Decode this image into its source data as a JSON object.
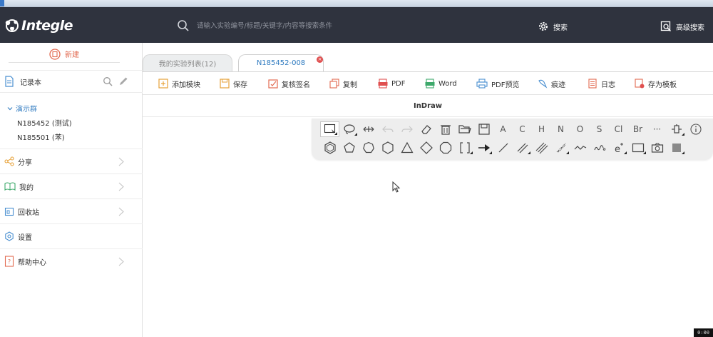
{
  "app": {
    "logo_text": "Integle",
    "search_placeholder": "请输入实验编号/标题/关键字/内容等搜索条件",
    "search_label": "搜索",
    "advanced_search_label": "高级搜索"
  },
  "sidebar": {
    "new_label": "新建",
    "notebook_label": "记录本",
    "group_label": "演示群",
    "tree_items": [
      {
        "label": "N185452 (测试)"
      },
      {
        "label": "N185501 (苯)"
      }
    ],
    "nav": [
      {
        "label": "分享",
        "icon": "share-icon"
      },
      {
        "label": "我的",
        "icon": "book-open-icon"
      },
      {
        "label": "回收站",
        "icon": "recycle-bin-icon"
      },
      {
        "label": "设置",
        "icon": "gear-icon"
      },
      {
        "label": "帮助中心",
        "icon": "help-icon"
      }
    ]
  },
  "tabs": [
    {
      "label": "我的实验列表(12)",
      "active": false
    },
    {
      "label": "N185452-008",
      "active": true
    }
  ],
  "toolbar": [
    {
      "label": "添加模块",
      "icon": "add-module-icon"
    },
    {
      "label": "保存",
      "icon": "save-icon"
    },
    {
      "label": "复核签名",
      "icon": "sign-icon"
    },
    {
      "label": "复制",
      "icon": "copy-icon"
    },
    {
      "label": "PDF",
      "icon": "pdf-icon"
    },
    {
      "label": "Word",
      "icon": "word-icon"
    },
    {
      "label": "PDF预览",
      "icon": "print-icon"
    },
    {
      "label": "痕迹",
      "icon": "trace-icon"
    },
    {
      "label": "日志",
      "icon": "log-icon"
    },
    {
      "label": "存为模板",
      "icon": "save-template-icon"
    }
  ],
  "editor": {
    "title": "InDraw",
    "palette_text_tools": [
      "A",
      "C",
      "H",
      "N",
      "O",
      "S",
      "Cl",
      "Br"
    ],
    "more_label": "···"
  },
  "colors": {
    "topbar_bg": "#2f333e",
    "accent_blue": "#2f7bc0",
    "accent_orange": "#e26a50",
    "close_red": "#e05050"
  },
  "corner_badge": "0:00"
}
